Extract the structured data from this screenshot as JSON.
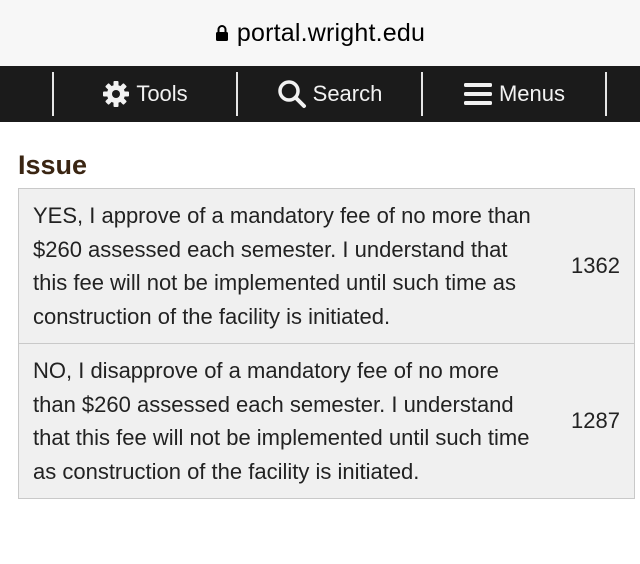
{
  "browser": {
    "url": "portal.wright.edu"
  },
  "nav": {
    "tools_label": "Tools",
    "search_label": "Search",
    "menus_label": "Menus"
  },
  "issue": {
    "title": "Issue",
    "options": [
      {
        "text": "YES, I approve of a mandatory fee of no more than $260 assessed each semester. I understand that this fee will not be implemented until such time as construction of the facility is initiated.",
        "count": "1362"
      },
      {
        "text": "NO, I disapprove of a mandatory fee of no more than $260 assessed each semester. I understand that this fee will not be implemented until such time as construction of the facility is initiated.",
        "count": "1287"
      }
    ]
  },
  "colors": {
    "nav_background": "#1b1b1b",
    "title_color": "#3a2512",
    "row_background": "#f0f0f0"
  }
}
